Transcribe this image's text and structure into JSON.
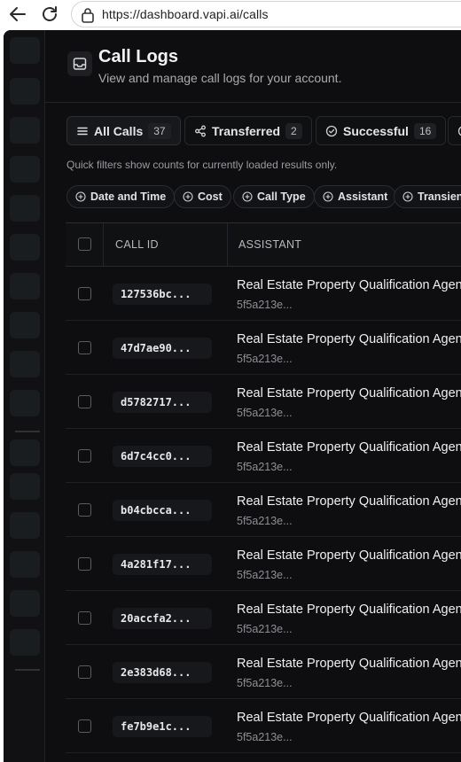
{
  "browser": {
    "url": "https://dashboard.vapi.ai/calls"
  },
  "header": {
    "title": "Call Logs",
    "subtitle": "View and manage call logs for your account."
  },
  "tabs": [
    {
      "label": "All Calls",
      "count": "37",
      "icon": "list-icon",
      "active": true
    },
    {
      "label": "Transferred",
      "count": "2",
      "icon": "share-icon",
      "active": false
    },
    {
      "label": "Successful",
      "count": "16",
      "icon": "check-circle-icon",
      "active": false
    }
  ],
  "hint": "Quick filters show counts for currently loaded results only.",
  "filters": [
    {
      "label": "Date and Time"
    },
    {
      "label": "Cost"
    },
    {
      "label": "Call Type"
    },
    {
      "label": "Assistant"
    },
    {
      "label": "Transient"
    }
  ],
  "table": {
    "columns": [
      "CALL ID",
      "ASSISTANT"
    ],
    "rows": [
      {
        "call_id": "127536bc...",
        "assistant": "Real Estate Property Qualification Agent",
        "assistant_id": "5f5a213e..."
      },
      {
        "call_id": "47d7ae90...",
        "assistant": "Real Estate Property Qualification Agent",
        "assistant_id": "5f5a213e..."
      },
      {
        "call_id": "d5782717...",
        "assistant": "Real Estate Property Qualification Agent",
        "assistant_id": "5f5a213e..."
      },
      {
        "call_id": "6d7c4cc0...",
        "assistant": "Real Estate Property Qualification Agent",
        "assistant_id": "5f5a213e..."
      },
      {
        "call_id": "b04cbcca...",
        "assistant": "Real Estate Property Qualification Agent",
        "assistant_id": "5f5a213e..."
      },
      {
        "call_id": "4a281f17...",
        "assistant": "Real Estate Property Qualification Agent",
        "assistant_id": "5f5a213e..."
      },
      {
        "call_id": "20accfa2...",
        "assistant": "Real Estate Property Qualification Agent",
        "assistant_id": "5f5a213e..."
      },
      {
        "call_id": "2e383d68...",
        "assistant": "Real Estate Property Qualification Agent",
        "assistant_id": "5f5a213e..."
      },
      {
        "call_id": "fe7b9e1c...",
        "assistant": "Real Estate Property Qualification Agent",
        "assistant_id": "5f5a213e..."
      }
    ]
  },
  "colors": {
    "app_bg": "#0e0e10",
    "sidebar_bg": "#111113",
    "text_primary": "#f2f2f2",
    "text_muted": "#a9aaae"
  }
}
